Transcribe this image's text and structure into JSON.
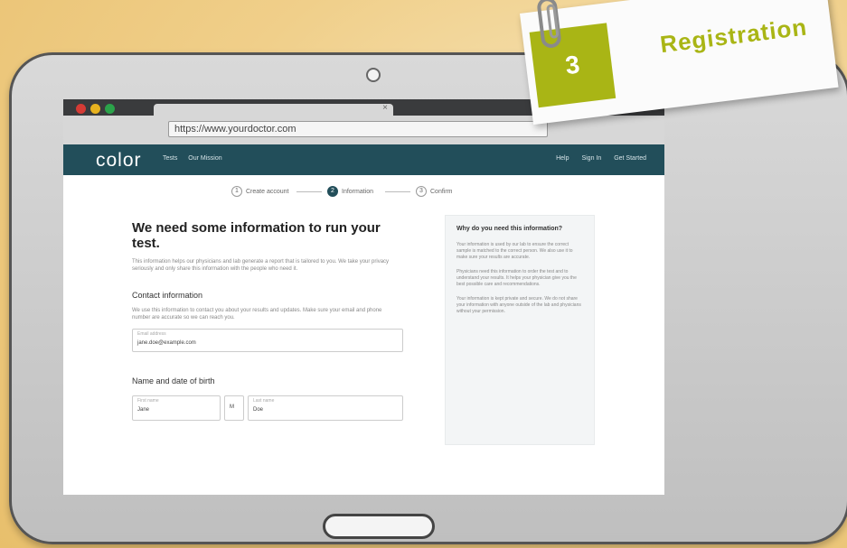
{
  "browser": {
    "tab_close": "×",
    "url": "https://www.yourdoctor.com"
  },
  "site": {
    "logo": "color",
    "nav_left": [
      "Tests",
      "Our Mission"
    ],
    "nav_right": [
      "Help",
      "Sign In",
      "Get Started"
    ]
  },
  "stepper": {
    "steps": [
      {
        "num": "1",
        "label": "Create account"
      },
      {
        "num": "2",
        "label": "Information"
      },
      {
        "num": "3",
        "label": "Confirm"
      }
    ]
  },
  "main": {
    "headline": "We need some information to run your test.",
    "intro": "This information helps our physicians and lab generate a report that is tailored to you. We take your privacy seriously and only share this information with the people who need it.",
    "contact": {
      "title": "Contact information",
      "text": "We use this information to contact you about your results and updates. Make sure your email and phone number are accurate so we can reach you.",
      "email_label": "Email address",
      "email_value": "jane.doe@example.com"
    },
    "name": {
      "title": "Name and date of birth",
      "first_label": "First name",
      "first_value": "Jane",
      "mi_value": "M",
      "last_label": "Last name",
      "last_value": "Doe"
    }
  },
  "sidebar": {
    "title": "Why do you need this information?",
    "paragraphs": [
      "Your information is used by our lab to ensure the correct sample is matched to the correct person. We also use it to make sure your results are accurate.",
      "Physicians need this information to order the test and to understand your results. It helps your physician give you the best possible care and recommendations.",
      "Your information is kept private and secure. We do not share your information with anyone outside of the lab and physicians without your permission."
    ]
  },
  "tag": {
    "number": "3",
    "title": "Registration"
  }
}
